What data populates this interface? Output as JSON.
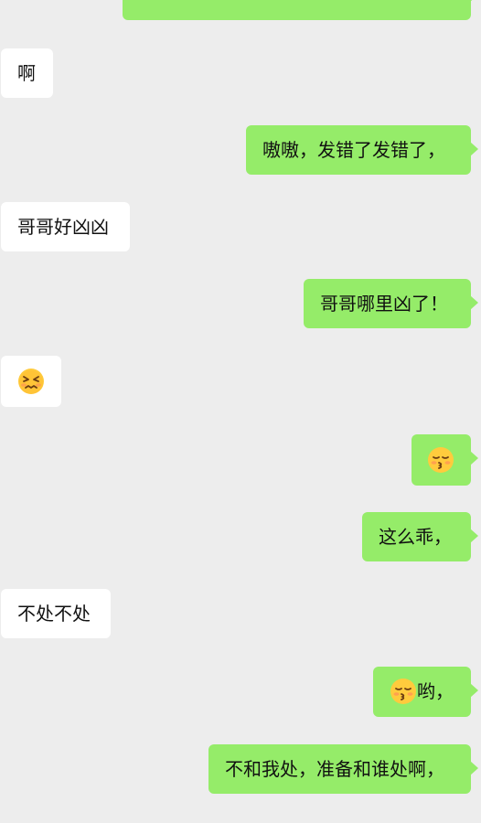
{
  "messages": [
    {
      "side": "out",
      "text": ""
    },
    {
      "side": "in",
      "text": "啊"
    },
    {
      "side": "out",
      "text": "嗷嗷，发错了发错了，"
    },
    {
      "side": "in",
      "text": "哥哥好凶凶"
    },
    {
      "side": "out",
      "text": "哥哥哪里凶了！"
    },
    {
      "side": "in",
      "emoji": "confounded-face"
    },
    {
      "side": "out",
      "emoji": "kissing-face-with-closed-eyes"
    },
    {
      "side": "out",
      "text": "这么乖，"
    },
    {
      "side": "in",
      "text": "不处不处"
    },
    {
      "side": "out",
      "emoji": "kissing-face-with-closed-eyes",
      "text": "哟，"
    },
    {
      "side": "out",
      "text": "不和我处，准备和谁处啊，"
    }
  ],
  "colors": {
    "background": "#ededed",
    "incoming_bubble": "#ffffff",
    "outgoing_bubble": "#95ec69"
  }
}
